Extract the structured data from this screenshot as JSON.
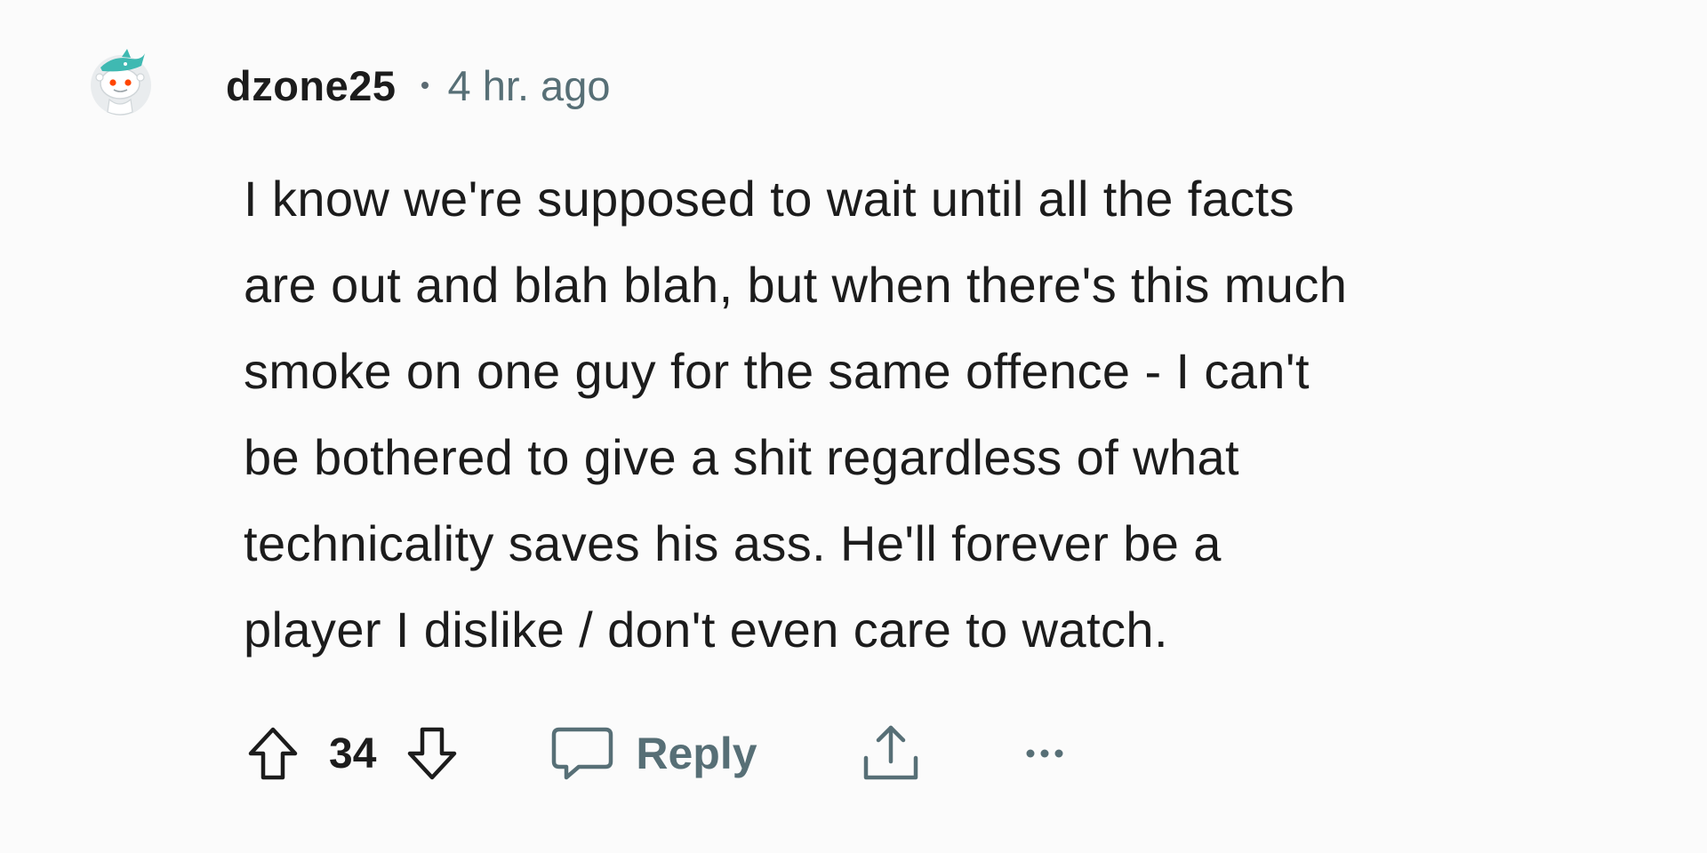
{
  "comment": {
    "author": "dzone25",
    "timestamp": "4 hr. ago",
    "body": "I know we're supposed to wait until all the facts\nare out and blah blah, but when there's this much\nsmoke on one guy for the same offence - I can't\nbe bothered to give a shit regardless of what\ntechnicality saves his ass. He'll forever be a\nplayer I dislike / don't even care to watch.",
    "score": "34",
    "reply_label": "Reply",
    "avatar_icon": "snoo-avatar-icon",
    "actions_icons": [
      "upvote-icon",
      "downvote-icon",
      "comment-icon",
      "share-icon",
      "more-options-icon"
    ]
  },
  "colors": {
    "background": "#fbfbfb",
    "text": "#1c1c1c",
    "muted": "#576f76",
    "avatar_accent": "#3fb9b2",
    "avatar_orange": "#ff4500"
  }
}
